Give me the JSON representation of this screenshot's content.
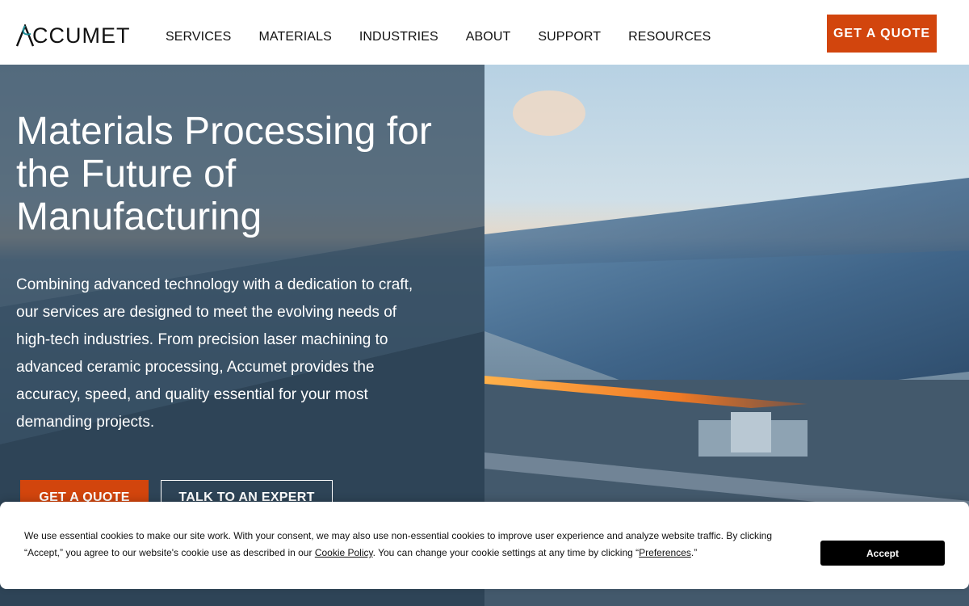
{
  "brand": {
    "name": "CCUMET",
    "accent": "#d2450d"
  },
  "nav": {
    "items": [
      {
        "label": "SERVICES"
      },
      {
        "label": "MATERIALS"
      },
      {
        "label": "INDUSTRIES"
      },
      {
        "label": "ABOUT"
      },
      {
        "label": "SUPPORT"
      },
      {
        "label": "RESOURCES"
      }
    ],
    "cta": "GET A QUOTE"
  },
  "hero": {
    "title": "Materials Processing for the Future of Manufacturing",
    "text": "Combining advanced technology with a dedication to craft, our services are designed to meet the evolving needs of high-tech industries. From precision laser machining to advanced ceramic processing, Accumet provides the accuracy, speed, and quality essential for your most demanding projects.",
    "buttons": {
      "quote": "GET A QUOTE",
      "expert": "TALK TO AN EXPERT"
    }
  },
  "cookie": {
    "text_before": "We use essential cookies to make our site work. With your consent, we may also use non-essential cookies to improve user experience and analyze website traffic. By clicking “Accept,” you agree to our website's cookie use as described in our ",
    "policy_link": "Cookie Policy",
    "text_middle": ". You can change your cookie settings at any time by clicking “",
    "preferences_link": "Preferences",
    "text_after": ".”",
    "accept": "Accept"
  }
}
